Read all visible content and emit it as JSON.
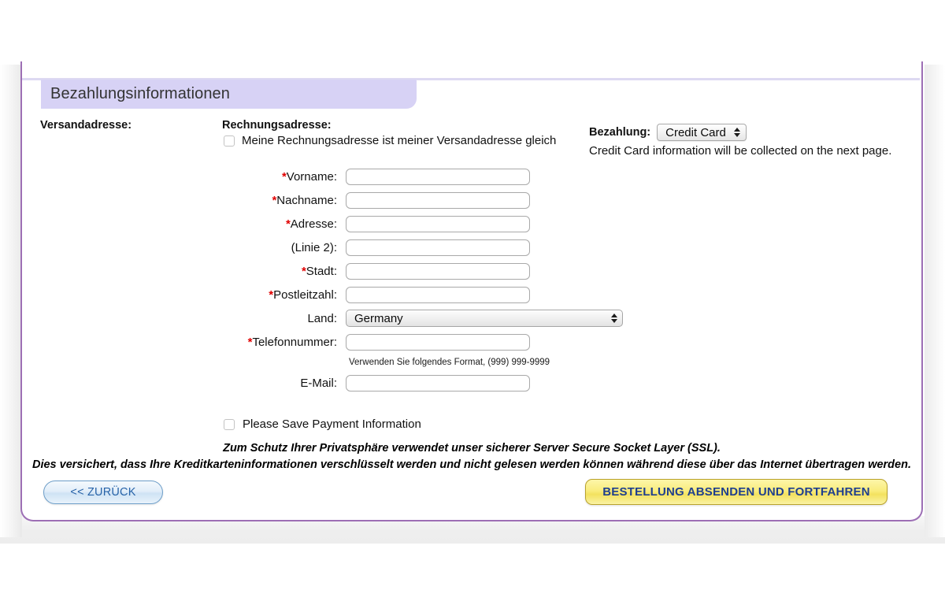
{
  "section": {
    "title": "Bezahlungsinformationen"
  },
  "columns": {
    "shipping_label": "Versandadresse:",
    "billing_label": "Rechnungsadresse:"
  },
  "same_address": {
    "label": "Meine Rechnungsadresse ist meiner Versandadresse gleich",
    "checked": false
  },
  "payment": {
    "label": "Bezahlung:",
    "selected": "Credit Card",
    "options": [
      "Credit Card"
    ],
    "note": "Credit Card information will be collected on the next page."
  },
  "form": {
    "fields": [
      {
        "required": true,
        "label": "Vorname:",
        "value": "",
        "placeholder": ""
      },
      {
        "required": true,
        "label": "Nachname:",
        "value": "",
        "placeholder": ""
      },
      {
        "required": true,
        "label": "Adresse:",
        "value": "",
        "placeholder": ""
      },
      {
        "required": false,
        "label": "(Linie 2):",
        "value": "",
        "placeholder": ""
      },
      {
        "required": true,
        "label": "Stadt:",
        "value": "",
        "placeholder": ""
      },
      {
        "required": true,
        "label": "Postleitzahl:",
        "value": "",
        "placeholder": ""
      }
    ],
    "country": {
      "required": false,
      "label": "Land:",
      "selected": "Germany",
      "options": [
        "Germany"
      ]
    },
    "phone": {
      "required": true,
      "label": "Telefonnummer:",
      "value": "",
      "hint": "Verwenden Sie folgendes Format, (999) 999-9999"
    },
    "email": {
      "required": false,
      "label": "E-Mail:",
      "value": ""
    }
  },
  "save_payment": {
    "label": "Please Save Payment Information",
    "checked": false
  },
  "ssl_notice": {
    "line1": "Zum Schutz Ihrer Privatsphäre verwendet unser sicherer Server Secure Socket Layer (SSL).",
    "line2": "Dies versichert, dass Ihre Kreditkarteninformationen verschlüsselt werden und nicht gelesen werden können während diese über das Internet übertragen werden."
  },
  "actions": {
    "back_label": "<< ZURÜCK",
    "submit_label": "BESTELLUNG ABSENDEN UND FORTFAHREN"
  },
  "colors": {
    "card_border": "#9d6fb5",
    "header_bg": "#d7d2f5",
    "required_star": "#e00000",
    "submit_bg": "#f9ec7d",
    "submit_text": "#1f3f8f",
    "back_text": "#2763a8"
  },
  "icons": {
    "select_arrows": "updown-arrows-icon",
    "checkbox": "checkbox-icon"
  }
}
